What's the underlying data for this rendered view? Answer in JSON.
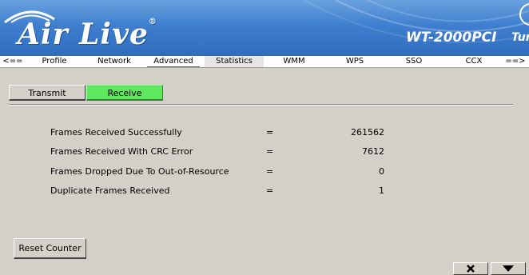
{
  "header": {
    "logo_text": "Air Live",
    "logo_reg": "®",
    "model": "WT-2000PCI",
    "turbo": "Tur"
  },
  "tabs": [
    {
      "label": "<=="
    },
    {
      "label": "Profile"
    },
    {
      "label": "Network"
    },
    {
      "label": "Advanced"
    },
    {
      "label": "Statistics",
      "active": true
    },
    {
      "label": "WMM"
    },
    {
      "label": "WPS"
    },
    {
      "label": "SSO"
    },
    {
      "label": "CCX"
    },
    {
      "label": "==>"
    }
  ],
  "subtabs": {
    "transmit": "Transmit",
    "receive": "Receive",
    "active": "Receive"
  },
  "stats": [
    {
      "label": "Frames Received Successfully",
      "eq": "=",
      "value": "261562"
    },
    {
      "label": "Frames Received With CRC Error",
      "eq": "=",
      "value": "7612"
    },
    {
      "label": "Frames Dropped Due To Out-of-Resource",
      "eq": "=",
      "value": "0"
    },
    {
      "label": "Duplicate Frames Received",
      "eq": "=",
      "value": "1"
    }
  ],
  "buttons": {
    "reset_counter": "Reset Counter"
  },
  "colors": {
    "banner": "#3f7fcf",
    "active_subtab": "#5ee85e",
    "window_bg": "#d4d0c8"
  },
  "icons": {
    "close": "close-icon",
    "minimize": "triangle-down-icon"
  }
}
